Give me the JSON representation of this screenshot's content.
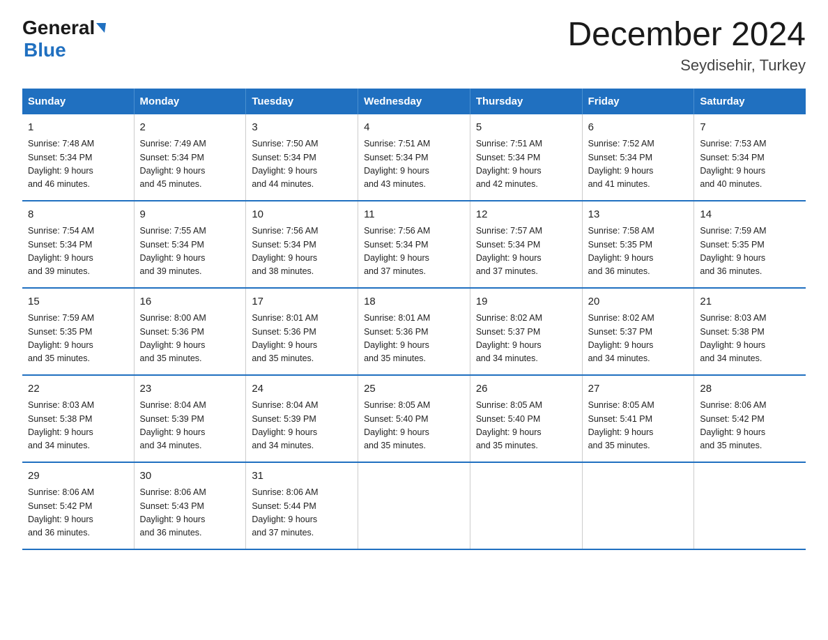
{
  "header": {
    "logo_general": "General",
    "logo_blue": "Blue",
    "title": "December 2024",
    "subtitle": "Seydisehir, Turkey"
  },
  "days_of_week": [
    "Sunday",
    "Monday",
    "Tuesday",
    "Wednesday",
    "Thursday",
    "Friday",
    "Saturday"
  ],
  "weeks": [
    [
      {
        "day": "1",
        "sunrise": "7:48 AM",
        "sunset": "5:34 PM",
        "daylight": "9 hours and 46 minutes."
      },
      {
        "day": "2",
        "sunrise": "7:49 AM",
        "sunset": "5:34 PM",
        "daylight": "9 hours and 45 minutes."
      },
      {
        "day": "3",
        "sunrise": "7:50 AM",
        "sunset": "5:34 PM",
        "daylight": "9 hours and 44 minutes."
      },
      {
        "day": "4",
        "sunrise": "7:51 AM",
        "sunset": "5:34 PM",
        "daylight": "9 hours and 43 minutes."
      },
      {
        "day": "5",
        "sunrise": "7:51 AM",
        "sunset": "5:34 PM",
        "daylight": "9 hours and 42 minutes."
      },
      {
        "day": "6",
        "sunrise": "7:52 AM",
        "sunset": "5:34 PM",
        "daylight": "9 hours and 41 minutes."
      },
      {
        "day": "7",
        "sunrise": "7:53 AM",
        "sunset": "5:34 PM",
        "daylight": "9 hours and 40 minutes."
      }
    ],
    [
      {
        "day": "8",
        "sunrise": "7:54 AM",
        "sunset": "5:34 PM",
        "daylight": "9 hours and 39 minutes."
      },
      {
        "day": "9",
        "sunrise": "7:55 AM",
        "sunset": "5:34 PM",
        "daylight": "9 hours and 39 minutes."
      },
      {
        "day": "10",
        "sunrise": "7:56 AM",
        "sunset": "5:34 PM",
        "daylight": "9 hours and 38 minutes."
      },
      {
        "day": "11",
        "sunrise": "7:56 AM",
        "sunset": "5:34 PM",
        "daylight": "9 hours and 37 minutes."
      },
      {
        "day": "12",
        "sunrise": "7:57 AM",
        "sunset": "5:34 PM",
        "daylight": "9 hours and 37 minutes."
      },
      {
        "day": "13",
        "sunrise": "7:58 AM",
        "sunset": "5:35 PM",
        "daylight": "9 hours and 36 minutes."
      },
      {
        "day": "14",
        "sunrise": "7:59 AM",
        "sunset": "5:35 PM",
        "daylight": "9 hours and 36 minutes."
      }
    ],
    [
      {
        "day": "15",
        "sunrise": "7:59 AM",
        "sunset": "5:35 PM",
        "daylight": "9 hours and 35 minutes."
      },
      {
        "day": "16",
        "sunrise": "8:00 AM",
        "sunset": "5:36 PM",
        "daylight": "9 hours and 35 minutes."
      },
      {
        "day": "17",
        "sunrise": "8:01 AM",
        "sunset": "5:36 PM",
        "daylight": "9 hours and 35 minutes."
      },
      {
        "day": "18",
        "sunrise": "8:01 AM",
        "sunset": "5:36 PM",
        "daylight": "9 hours and 35 minutes."
      },
      {
        "day": "19",
        "sunrise": "8:02 AM",
        "sunset": "5:37 PM",
        "daylight": "9 hours and 34 minutes."
      },
      {
        "day": "20",
        "sunrise": "8:02 AM",
        "sunset": "5:37 PM",
        "daylight": "9 hours and 34 minutes."
      },
      {
        "day": "21",
        "sunrise": "8:03 AM",
        "sunset": "5:38 PM",
        "daylight": "9 hours and 34 minutes."
      }
    ],
    [
      {
        "day": "22",
        "sunrise": "8:03 AM",
        "sunset": "5:38 PM",
        "daylight": "9 hours and 34 minutes."
      },
      {
        "day": "23",
        "sunrise": "8:04 AM",
        "sunset": "5:39 PM",
        "daylight": "9 hours and 34 minutes."
      },
      {
        "day": "24",
        "sunrise": "8:04 AM",
        "sunset": "5:39 PM",
        "daylight": "9 hours and 34 minutes."
      },
      {
        "day": "25",
        "sunrise": "8:05 AM",
        "sunset": "5:40 PM",
        "daylight": "9 hours and 35 minutes."
      },
      {
        "day": "26",
        "sunrise": "8:05 AM",
        "sunset": "5:40 PM",
        "daylight": "9 hours and 35 minutes."
      },
      {
        "day": "27",
        "sunrise": "8:05 AM",
        "sunset": "5:41 PM",
        "daylight": "9 hours and 35 minutes."
      },
      {
        "day": "28",
        "sunrise": "8:06 AM",
        "sunset": "5:42 PM",
        "daylight": "9 hours and 35 minutes."
      }
    ],
    [
      {
        "day": "29",
        "sunrise": "8:06 AM",
        "sunset": "5:42 PM",
        "daylight": "9 hours and 36 minutes."
      },
      {
        "day": "30",
        "sunrise": "8:06 AM",
        "sunset": "5:43 PM",
        "daylight": "9 hours and 36 minutes."
      },
      {
        "day": "31",
        "sunrise": "8:06 AM",
        "sunset": "5:44 PM",
        "daylight": "9 hours and 37 minutes."
      },
      {
        "day": "",
        "sunrise": "",
        "sunset": "",
        "daylight": ""
      },
      {
        "day": "",
        "sunrise": "",
        "sunset": "",
        "daylight": ""
      },
      {
        "day": "",
        "sunrise": "",
        "sunset": "",
        "daylight": ""
      },
      {
        "day": "",
        "sunrise": "",
        "sunset": "",
        "daylight": ""
      }
    ]
  ],
  "labels": {
    "sunrise_prefix": "Sunrise: ",
    "sunset_prefix": "Sunset: ",
    "daylight_prefix": "Daylight: "
  }
}
